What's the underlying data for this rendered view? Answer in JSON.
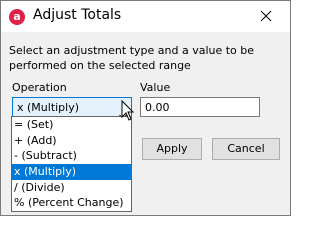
{
  "window": {
    "title": "Adjust Totals",
    "app_icon_glyph": "a",
    "brand_color": "#e0204a"
  },
  "instructions": "Select an adjustment type and a value to be performed on the selected range",
  "operation": {
    "label": "Operation",
    "selected": "x (Multiply)",
    "options": [
      "= (Set)",
      "+ (Add)",
      "- (Subtract)",
      "x (Multiply)",
      "/ (Divide)",
      "% (Percent Change)"
    ],
    "highlighted_index": 3
  },
  "value": {
    "label": "Value",
    "current": "0.00"
  },
  "buttons": {
    "apply": "Apply",
    "cancel": "Cancel"
  },
  "colors": {
    "selection": "#0078d7",
    "dialog_bg": "#f0f0f0"
  }
}
